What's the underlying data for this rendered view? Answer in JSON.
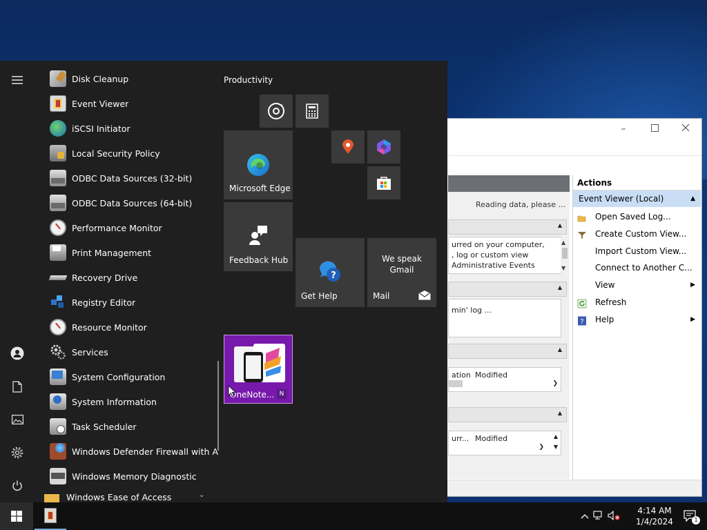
{
  "start_menu": {
    "apps": [
      {
        "label": "Disk Cleanup",
        "icon": "disk-cleanup-icon"
      },
      {
        "label": "Event Viewer",
        "icon": "event-viewer-icon"
      },
      {
        "label": "iSCSI Initiator",
        "icon": "iscsi-icon"
      },
      {
        "label": "Local Security Policy",
        "icon": "security-policy-icon"
      },
      {
        "label": "ODBC Data Sources (32-bit)",
        "icon": "odbc-icon"
      },
      {
        "label": "ODBC Data Sources (64-bit)",
        "icon": "odbc-icon"
      },
      {
        "label": "Performance Monitor",
        "icon": "performance-monitor-icon"
      },
      {
        "label": "Print Management",
        "icon": "print-management-icon"
      },
      {
        "label": "Recovery Drive",
        "icon": "recovery-drive-icon"
      },
      {
        "label": "Registry Editor",
        "icon": "registry-editor-icon"
      },
      {
        "label": "Resource Monitor",
        "icon": "resource-monitor-icon"
      },
      {
        "label": "Services",
        "icon": "services-icon"
      },
      {
        "label": "System Configuration",
        "icon": "system-configuration-icon"
      },
      {
        "label": "System Information",
        "icon": "system-information-icon"
      },
      {
        "label": "Task Scheduler",
        "icon": "task-scheduler-icon"
      },
      {
        "label": "Windows Defender Firewall with Ad...",
        "icon": "firewall-icon"
      },
      {
        "label": "Windows Memory Diagnostic",
        "icon": "memory-diagnostic-icon"
      },
      {
        "label": "Windows Ease of Access",
        "icon": "folder-icon"
      }
    ],
    "tiles_heading": "Productivity",
    "tiles": {
      "edge": "Microsoft Edge",
      "feedback": "Feedback Hub",
      "gethelp": "Get Help",
      "mail_label": "Mail",
      "mail_text": "We speak Gmail",
      "onenote": "OneNote..."
    }
  },
  "event_viewer": {
    "reading": "Reading data, please ...",
    "box1": [
      "urred on your computer,",
      ", log or custom view",
      "Administrative Events"
    ],
    "box2": "min' log ...",
    "col_a": "ation",
    "col_b": "Modified",
    "col_c": "urr...",
    "col_d": "Modified",
    "actions_title": "Actions",
    "actions_selected": "Event Viewer (Local)",
    "actions": [
      {
        "label": "Open Saved Log...",
        "icon": "open-folder-icon"
      },
      {
        "label": "Create Custom View...",
        "icon": "filter-icon"
      },
      {
        "label": "Import Custom View...",
        "icon": ""
      },
      {
        "label": "Connect to Another C...",
        "icon": ""
      },
      {
        "label": "View",
        "icon": "",
        "submenu": true
      },
      {
        "label": "Refresh",
        "icon": "refresh-icon"
      },
      {
        "label": "Help",
        "icon": "help-icon",
        "submenu": true
      }
    ]
  },
  "taskbar": {
    "time": "4:14 AM",
    "date": "1/4/2024",
    "notification_count": "1"
  },
  "colors": {
    "start_bg": "#1f1f1f",
    "tile_bg": "#3a3a3a",
    "onenote_purple": "#7719aa",
    "selection_blue": "#c9def5"
  }
}
